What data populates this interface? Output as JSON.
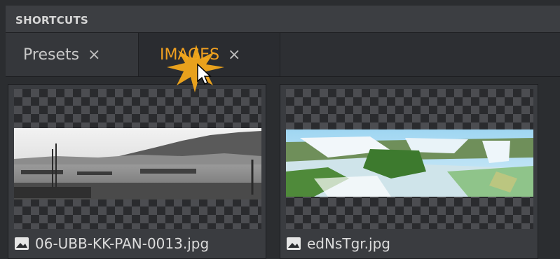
{
  "panel": {
    "title": "SHORTCUTS"
  },
  "tabs": [
    {
      "label": "Presets",
      "close": "×",
      "active": false
    },
    {
      "label": "IMAGES",
      "close": "×",
      "active": true
    }
  ],
  "images": [
    {
      "filename": "06-UBB-KK-PAN-0013.jpg",
      "icon": "image-icon"
    },
    {
      "filename": "edNsTgr.jpg",
      "icon": "image-icon"
    }
  ],
  "colors": {
    "active_tab_text": "#f0a020",
    "inactive_tab_text": "#c8c8c8",
    "header_bg": "#3c3e42",
    "panel_bg": "#2b2d30"
  }
}
